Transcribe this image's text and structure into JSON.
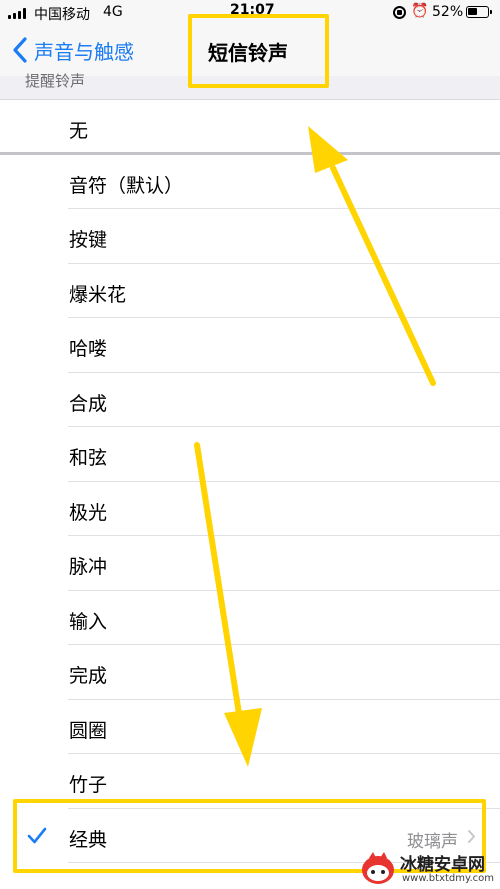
{
  "status_bar": {
    "carrier": "中国移动",
    "network": "4G",
    "time": "21:07",
    "battery": "52%"
  },
  "nav": {
    "back_label": "声音与触感",
    "title": "短信铃声"
  },
  "section": {
    "header": "提醒铃声"
  },
  "tones": [
    {
      "label": "无"
    },
    {
      "label": "音符（默认）"
    },
    {
      "label": "按键"
    },
    {
      "label": "爆米花"
    },
    {
      "label": "哈喽"
    },
    {
      "label": "合成"
    },
    {
      "label": "和弦"
    },
    {
      "label": "极光"
    },
    {
      "label": "脉冲"
    },
    {
      "label": "输入"
    },
    {
      "label": "完成"
    },
    {
      "label": "圆圈"
    },
    {
      "label": "竹子"
    },
    {
      "label": "经典",
      "detail": "玻璃声",
      "selected": true
    }
  ],
  "watermark": {
    "name": "冰糖安卓网",
    "url": "www.btxtdmy.com"
  },
  "colors": {
    "accent": "#1c7cf4",
    "highlight": "#ffd400",
    "separator": "#e1e1e4",
    "secondary_text": "#8e8e93"
  }
}
